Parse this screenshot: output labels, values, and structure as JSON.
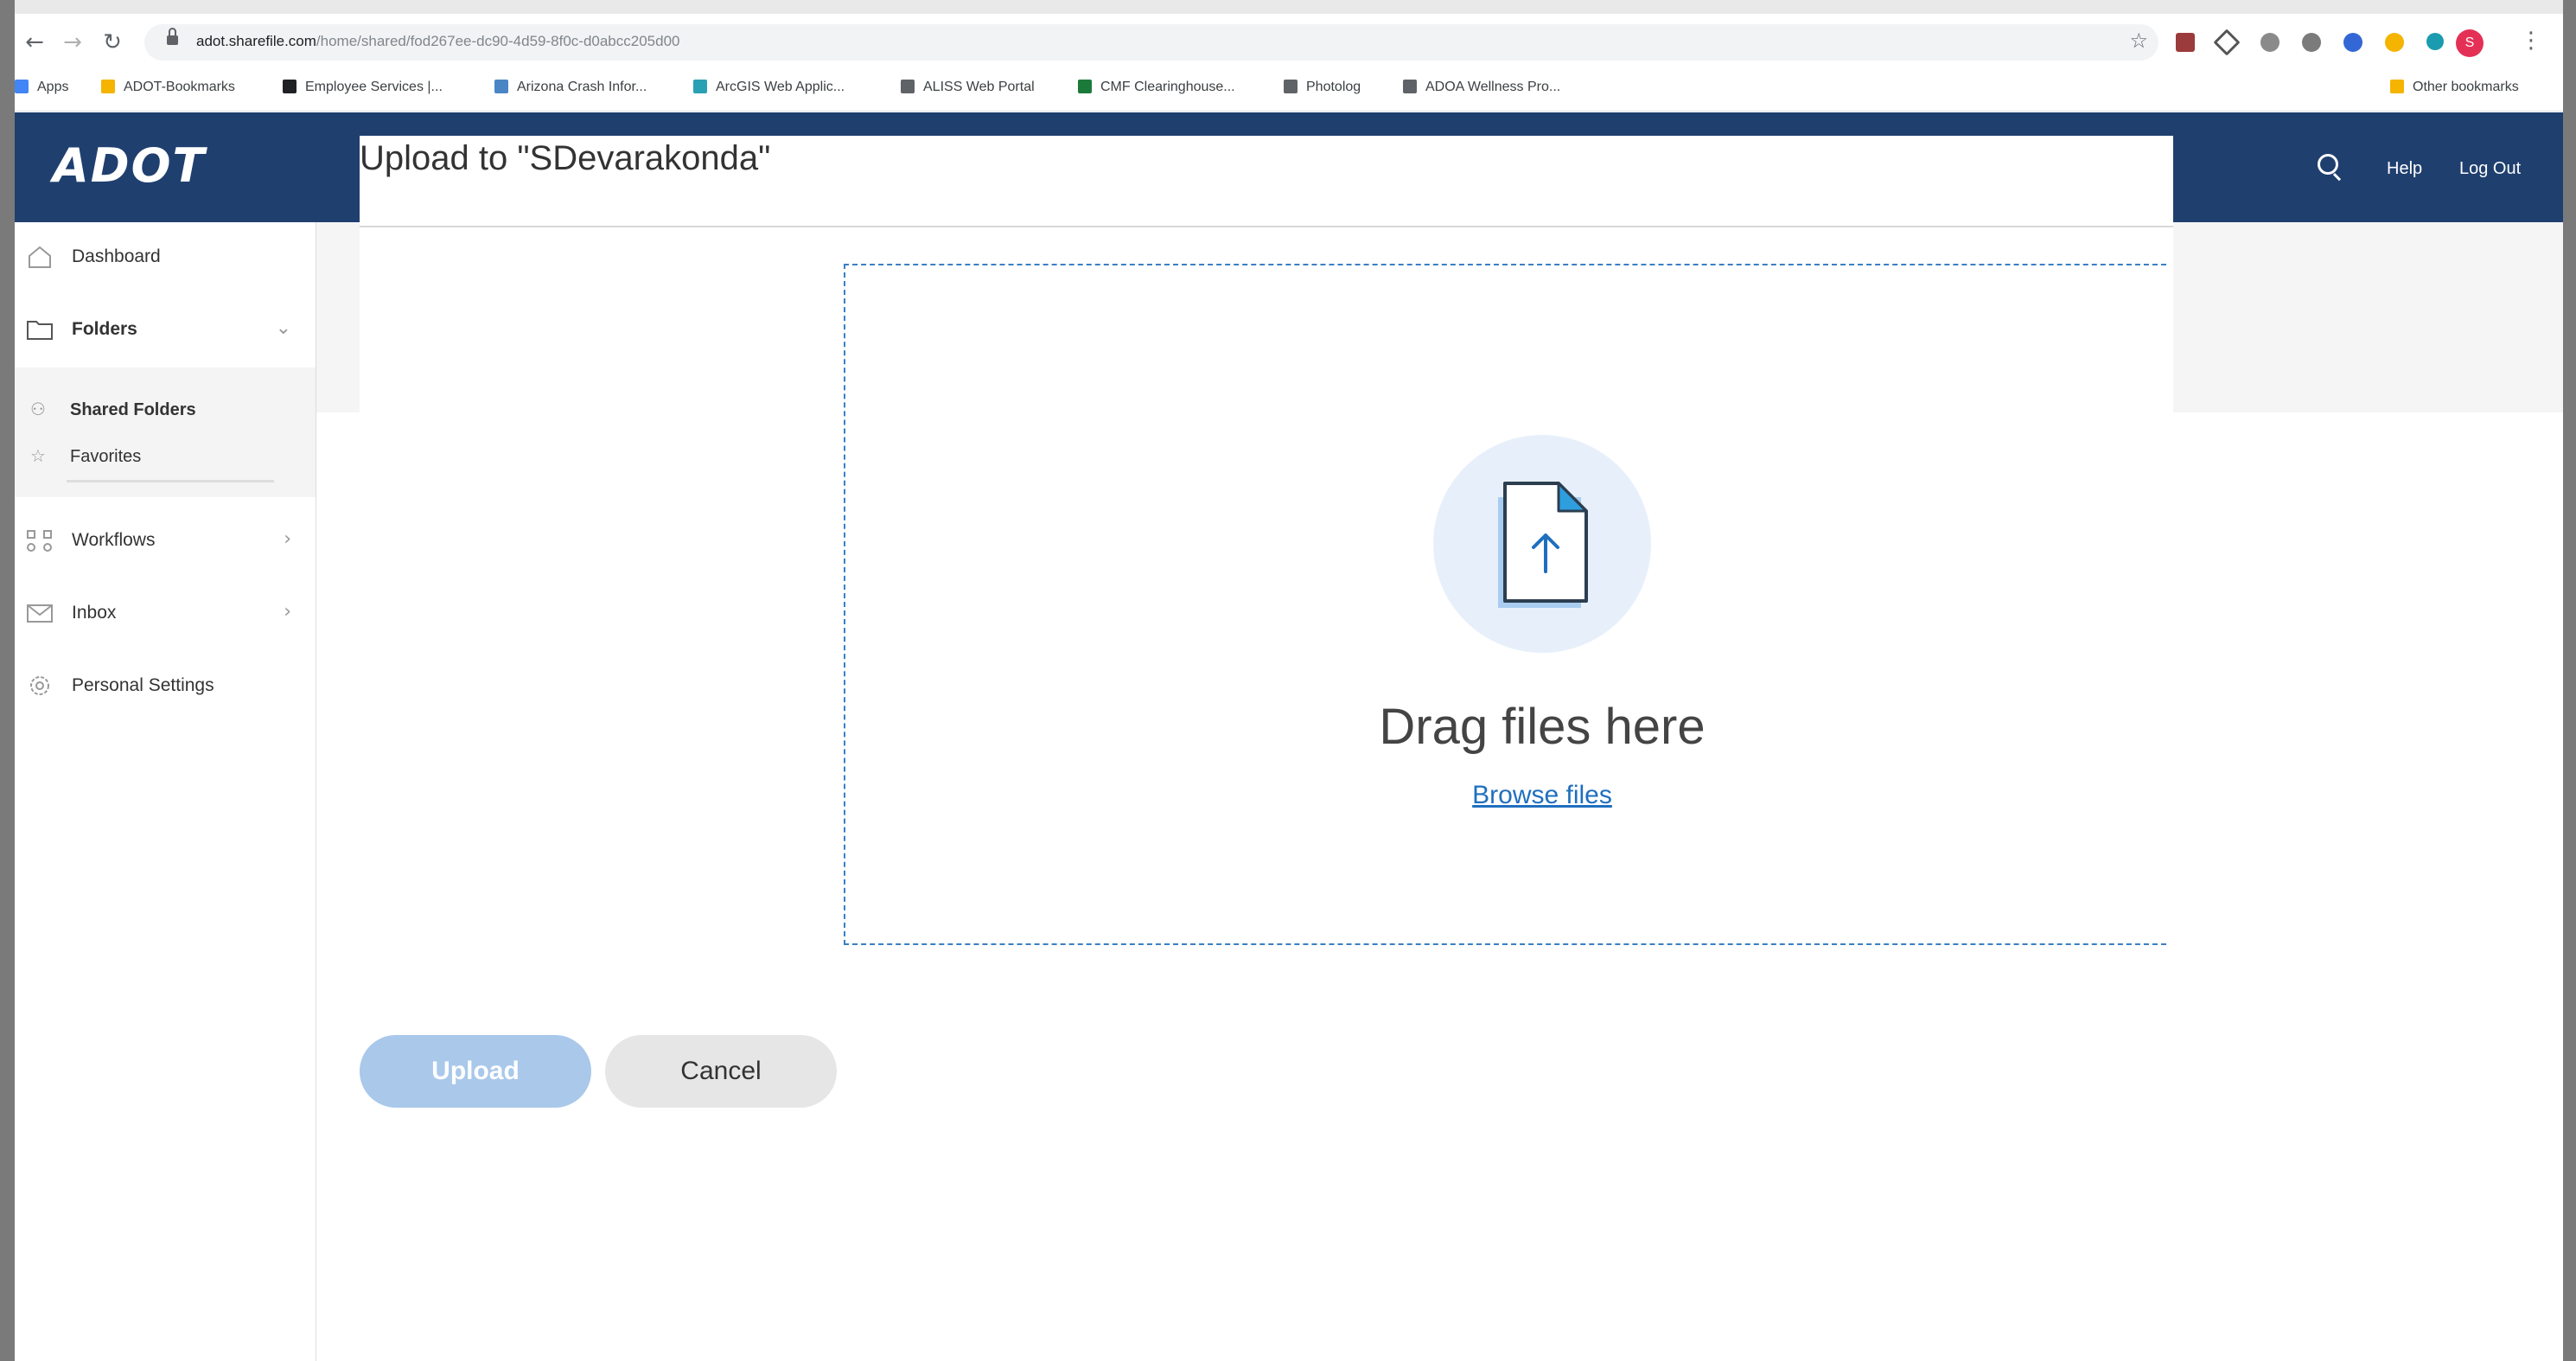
{
  "browser": {
    "url_host": "adot.sharefile.com",
    "url_path": "/home/shared/fod267ee-dc90-4d59-8f0c-d0abcc205d00",
    "bookmarks": [
      {
        "label": "Apps",
        "color": "#4285f4"
      },
      {
        "label": "ADOT-Bookmarks",
        "color": "#f4b400"
      },
      {
        "label": "Employee Services |...",
        "color": "#202124"
      },
      {
        "label": "Arizona Crash Infor...",
        "color": "#4a86c5"
      },
      {
        "label": "ArcGIS Web Applic...",
        "color": "#2aa0b4"
      },
      {
        "label": "ALISS Web Portal",
        "color": "#5f6368"
      },
      {
        "label": "CMF Clearinghouse...",
        "color": "#1b7a3a"
      },
      {
        "label": "Photolog",
        "color": "#5f6368"
      },
      {
        "label": "ADOA Wellness Pro...",
        "color": "#5f6368"
      }
    ],
    "other_bookmarks": "Other bookmarks",
    "profile_initial": "S"
  },
  "app": {
    "logo": "ADOT",
    "help": "Help",
    "logout": "Log Out"
  },
  "sidebar": {
    "dashboard": "Dashboard",
    "folders": "Folders",
    "shared_folders": "Shared Folders",
    "favorites": "Favorites",
    "workflows": "Workflows",
    "inbox": "Inbox",
    "personal_settings": "Personal Settings"
  },
  "modal": {
    "title": "Upload to \"SDevarakonda\"",
    "drag_text": "Drag files here",
    "browse_text": "Browse files",
    "upload_label": "Upload",
    "cancel_label": "Cancel"
  },
  "colors": {
    "brand": "#1f3f6f",
    "accent": "#1f6fbf",
    "upload_disabled": "#a9c8ea"
  }
}
